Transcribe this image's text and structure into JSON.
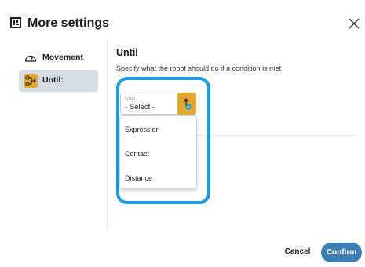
{
  "dialog": {
    "title": "More settings",
    "logo_icon": "ur-logo-icon",
    "close_icon": "close-icon"
  },
  "sidebar": {
    "items": [
      {
        "label": "Movement",
        "icon": "gauge-icon",
        "active": false
      },
      {
        "label": "Until:",
        "icon": "until-node-icon",
        "active": true
      }
    ]
  },
  "main": {
    "title": "Until",
    "description": "Specify what the robot should do if a condition is met",
    "select": {
      "caption": "Until",
      "value": "- Select -",
      "expression_button_icon": "expression-hand-icon"
    },
    "dropdown_options": [
      "Expression",
      "Contact",
      "Distance"
    ]
  },
  "footer": {
    "cancel_label": "Cancel",
    "confirm_label": "Confirm"
  },
  "colors": {
    "highlight": "#1c9be6",
    "accent_yellow": "#e2a72e",
    "confirm": "#3b7fb5",
    "active_item": "#d4dde6"
  }
}
